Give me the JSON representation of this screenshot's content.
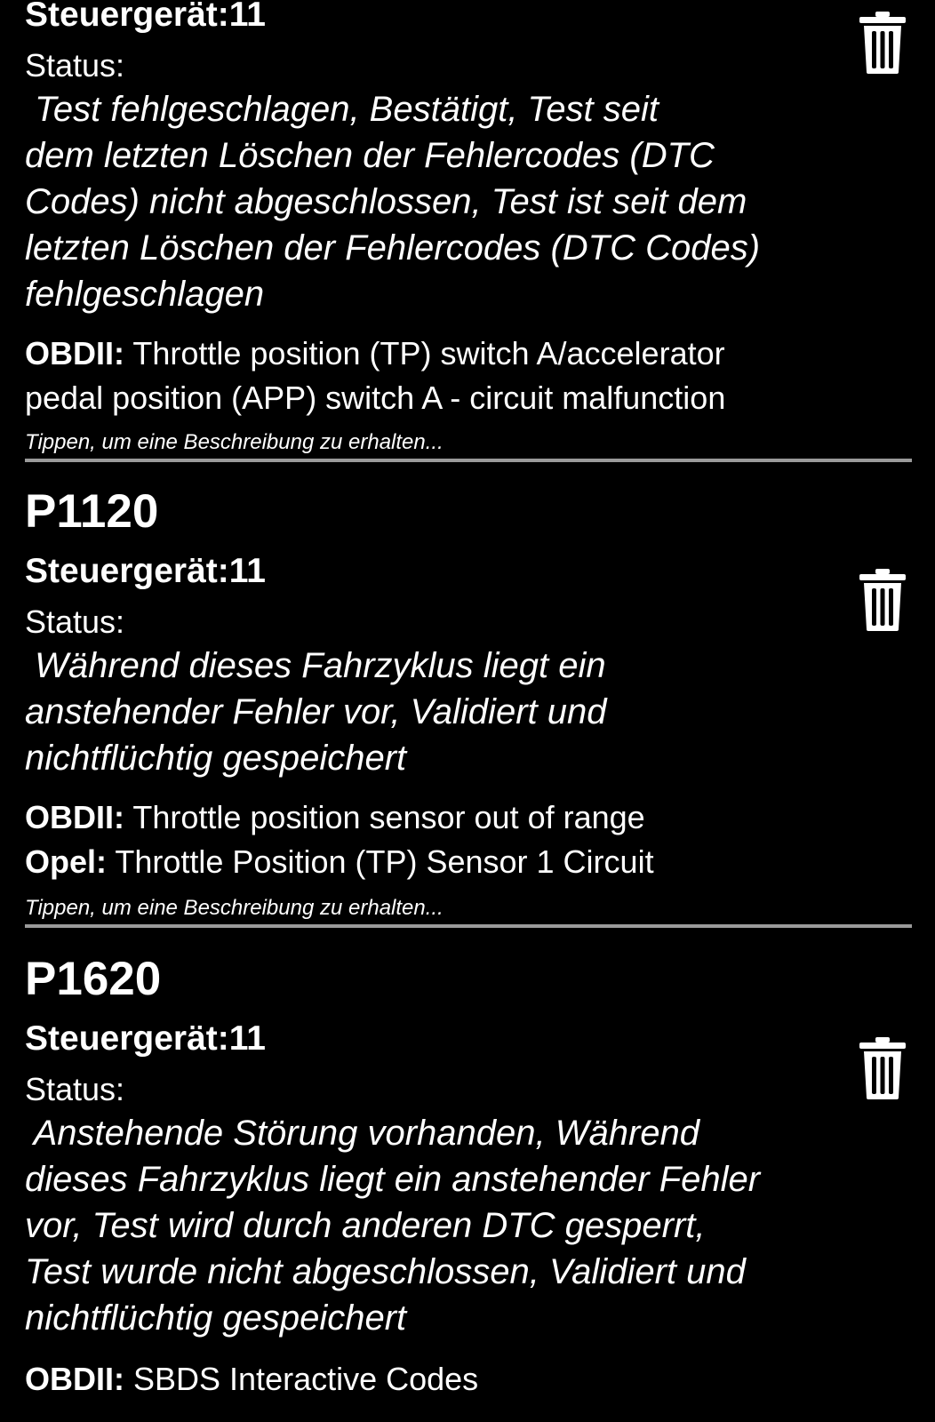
{
  "icons": {
    "delete": "trash-icon"
  },
  "entries": [
    {
      "code": "",
      "unit": "Steuergerät:11",
      "status_label": "Status:",
      "status_lines": [
        " Test fehlgeschlagen, Bestätigt, Test seit",
        "dem letzten Löschen der Fehlercodes (DTC",
        "Codes) nicht abgeschlossen, Test ist seit dem",
        "letzten Löschen der Fehlercodes (DTC Codes)",
        "fehlgeschlagen"
      ],
      "descriptions": [
        {
          "label": "OBDII:",
          "text": " Throttle position (TP) switch A/accelerator"
        },
        {
          "label": "",
          "text": "pedal position (APP) switch A - circuit malfunction"
        }
      ],
      "hint": "Tippen, um eine Beschreibung zu erhalten..."
    },
    {
      "code": "P1120",
      "unit": "Steuergerät:11",
      "status_label": "Status:",
      "status_lines": [
        " Während dieses Fahrzyklus liegt ein",
        "anstehender Fehler vor, Validiert und",
        "nichtflüchtig gespeichert"
      ],
      "descriptions": [
        {
          "label": "OBDII:",
          "text": " Throttle position sensor out of range"
        },
        {
          "label": "Opel:",
          "text": " Throttle Position (TP) Sensor 1 Circuit"
        }
      ],
      "hint": "Tippen, um eine Beschreibung zu erhalten..."
    },
    {
      "code": "P1620",
      "unit": "Steuergerät:11",
      "status_label": "Status:",
      "status_lines": [
        " Anstehende Störung vorhanden, Während",
        "dieses Fahrzyklus liegt ein anstehender Fehler",
        "vor, Test wird durch anderen DTC gesperrt,",
        "Test wurde nicht abgeschlossen, Validiert und",
        "nichtflüchtig gespeichert"
      ],
      "descriptions": [
        {
          "label": "OBDII:",
          "text": " SBDS Interactive Codes"
        }
      ],
      "hint": ""
    }
  ]
}
